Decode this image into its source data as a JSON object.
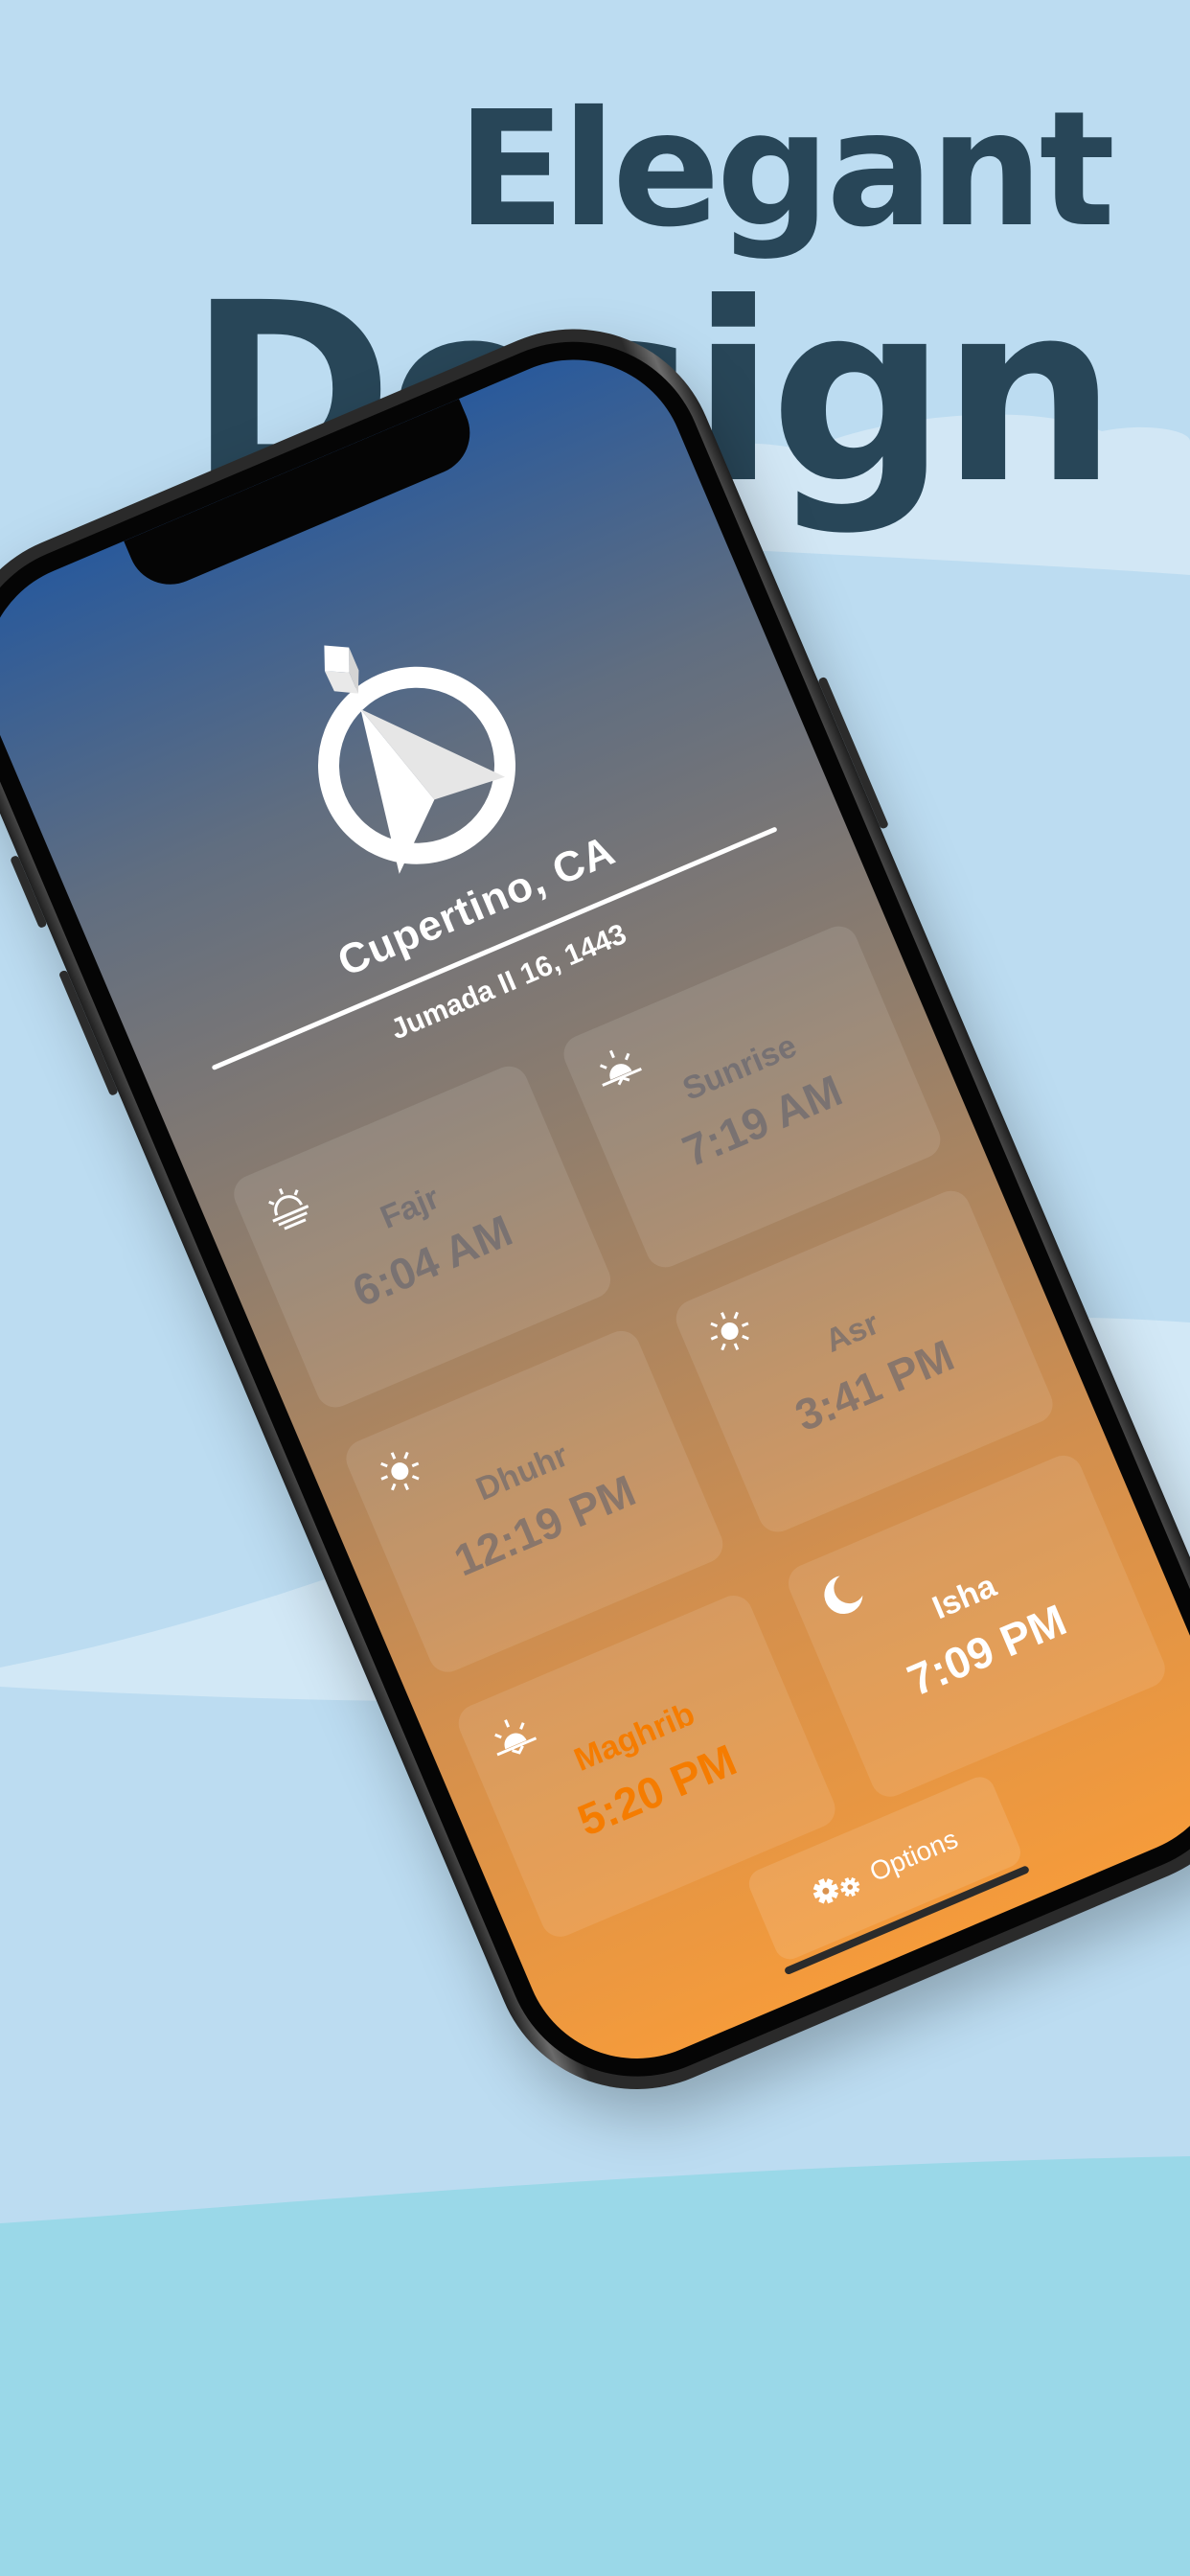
{
  "headline": {
    "line1": "Elegant",
    "line2": "Design"
  },
  "app": {
    "location": "Cupertino, CA",
    "hijri_date": "Jumada II 16, 1443",
    "prayers": [
      {
        "name": "Fajr",
        "time": "6:04 AM",
        "icon": "sunrise-lines-icon",
        "state": "past"
      },
      {
        "name": "Sunrise",
        "time": "7:19 AM",
        "icon": "sun-horizon-icon",
        "state": "past"
      },
      {
        "name": "Dhuhr",
        "time": "12:19 PM",
        "icon": "sun-icon",
        "state": "past"
      },
      {
        "name": "Asr",
        "time": "3:41 PM",
        "icon": "sun-icon",
        "state": "past"
      },
      {
        "name": "Maghrib",
        "time": "5:20 PM",
        "icon": "sunset-icon",
        "state": "current"
      },
      {
        "name": "Isha",
        "time": "7:09 PM",
        "icon": "moon-icon",
        "state": "upcoming"
      }
    ],
    "options_label": "Options"
  },
  "colors": {
    "background": "#bcdcf1",
    "headline": "#284658",
    "gradient_top": "#2a5a9b",
    "gradient_bottom": "#f59b3b",
    "current_prayer": "#f57c00"
  }
}
